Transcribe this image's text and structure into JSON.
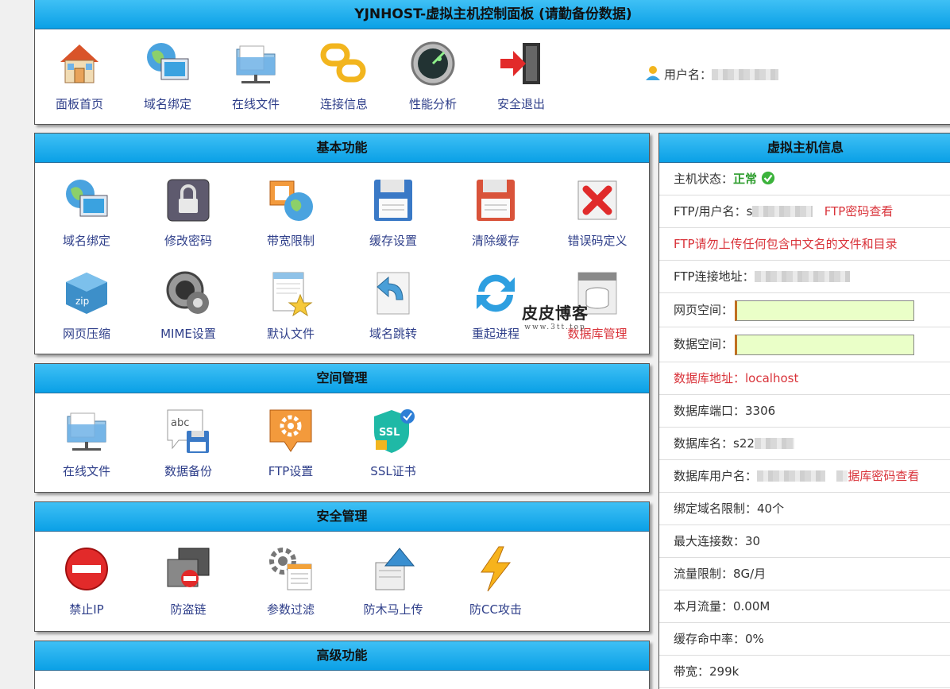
{
  "header": {
    "title": "YJNHOST-虚拟主机控制面板 (请勤备份数据)"
  },
  "top_nav": [
    {
      "label": "面板首页",
      "icon": "home-icon"
    },
    {
      "label": "域名绑定",
      "icon": "globe-monitor-icon"
    },
    {
      "label": "在线文件",
      "icon": "network-folder-icon"
    },
    {
      "label": "连接信息",
      "icon": "chain-link-icon"
    },
    {
      "label": "性能分析",
      "icon": "radar-icon"
    },
    {
      "label": "安全退出",
      "icon": "exit-door-icon"
    }
  ],
  "user": {
    "label": "用户名："
  },
  "sections": {
    "basic": {
      "title": "基本功能",
      "items": [
        {
          "label": "域名绑定",
          "icon": "globe-monitor-icon"
        },
        {
          "label": "修改密码",
          "icon": "padlock-icon"
        },
        {
          "label": "带宽限制",
          "icon": "bandwidth-globe-icon"
        },
        {
          "label": "缓存设置",
          "icon": "floppy-disk-icon"
        },
        {
          "label": "清除缓存",
          "icon": "red-floppy-icon"
        },
        {
          "label": "错误码定义",
          "icon": "red-x-icon"
        },
        {
          "label": "网页压缩",
          "icon": "zip-box-icon"
        },
        {
          "label": "MIME设置",
          "icon": "speaker-gear-icon"
        },
        {
          "label": "默认文件",
          "icon": "document-star-icon"
        },
        {
          "label": "域名跳转",
          "icon": "redirect-arrow-icon"
        },
        {
          "label": "重起进程",
          "icon": "refresh-icon"
        },
        {
          "label": "数据库管理",
          "icon": "sql-database-icon"
        }
      ]
    },
    "space": {
      "title": "空间管理",
      "items": [
        {
          "label": "在线文件",
          "icon": "network-folder-icon"
        },
        {
          "label": "数据备份",
          "icon": "backup-disk-icon"
        },
        {
          "label": "FTP设置",
          "icon": "ftp-gear-icon"
        },
        {
          "label": "SSL证书",
          "icon": "ssl-shield-icon"
        }
      ]
    },
    "security": {
      "title": "安全管理",
      "items": [
        {
          "label": "禁止IP",
          "icon": "no-entry-icon"
        },
        {
          "label": "防盗链",
          "icon": "anti-leech-icon"
        },
        {
          "label": "参数过滤",
          "icon": "gear-list-icon"
        },
        {
          "label": "防木马上传",
          "icon": "upload-arrow-icon"
        },
        {
          "label": "防CC攻击",
          "icon": "lightning-icon"
        }
      ]
    },
    "advanced": {
      "title": "高级功能"
    }
  },
  "host_info": {
    "title": "虚拟主机信息",
    "status_label": "主机状态：",
    "status_value": "正常",
    "ftp_user_label": "FTP/用户名：",
    "ftp_user_value": "s",
    "ftp_pwd_link": "FTP密码查看",
    "ftp_warning": "FTP请勿上传任何包含中文名的文件和目录",
    "ftp_addr_label": "FTP连接地址：",
    "web_space_label": "网页空间：",
    "web_space_used_fraction": 0.0,
    "db_space_label": "数据空间：",
    "db_space_used_fraction": 0.0,
    "db_addr": "数据库地址：localhost",
    "db_port": "数据库端口：3306",
    "db_name_label": "数据库名：",
    "db_name_value": "s22",
    "db_user_label": "数据库用户名：",
    "db_pwd_link": "据库密码查看",
    "domain_limit": "绑定域名限制：40个",
    "max_conn": "最大连接数：30",
    "traffic_limit": "流量限制：8G/月",
    "month_traffic": "本月流量：0.00M",
    "cache_hit": "缓存命中率：0%",
    "bandwidth": "带宽：299k"
  },
  "watermark": {
    "title": "皮皮博客",
    "url": "www.3tt.top"
  },
  "colors": {
    "header_blue": "#0aa0e6",
    "link_red": "#d9333a",
    "label_navy": "#2f3f8a",
    "ok_green": "#2e9d2e",
    "bar_fill": "#eaffc8"
  }
}
